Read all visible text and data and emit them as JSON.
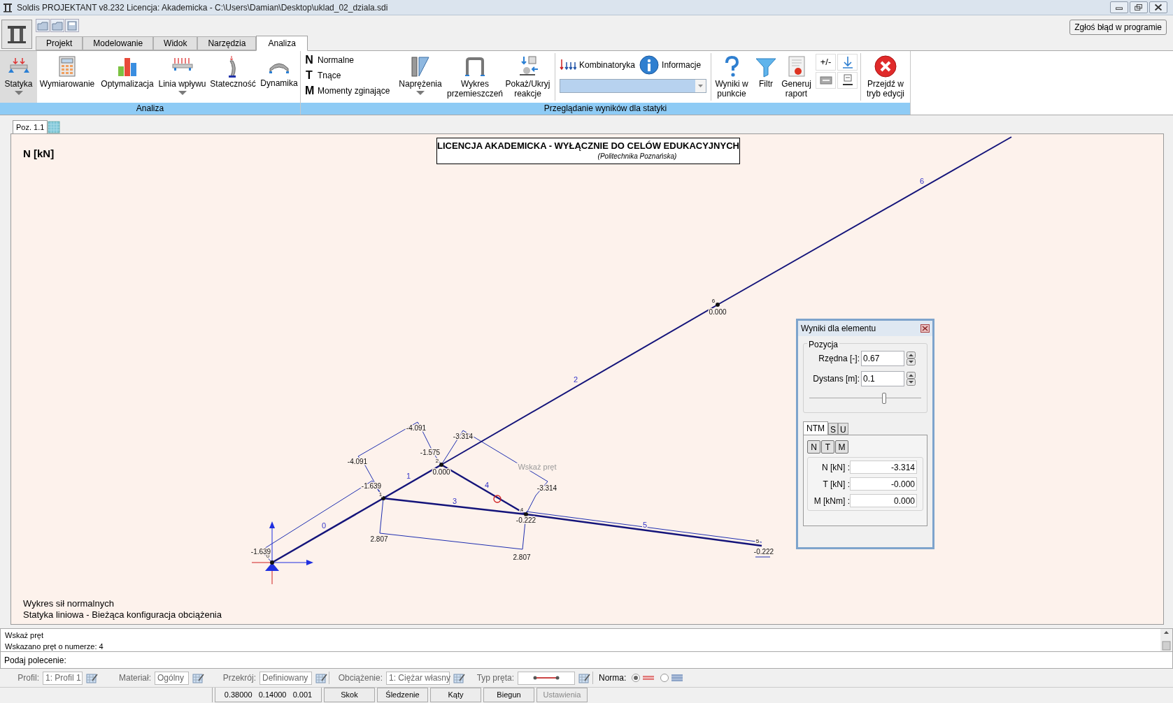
{
  "window": {
    "title": "Soldis PROJEKTANT v8.232 Licencja: Akademicka - C:\\Users\\Damian\\Desktop\\uklad_02_dziala.sdi"
  },
  "report_button": "Zgłoś błąd w programie",
  "tabs": [
    {
      "label": "Projekt",
      "selected": false
    },
    {
      "label": "Modelowanie",
      "selected": false
    },
    {
      "label": "Widok",
      "selected": false
    },
    {
      "label": "Narzędzia",
      "selected": false
    },
    {
      "label": "Analiza",
      "selected": true
    }
  ],
  "analysis_group": {
    "label": "Analiza",
    "buttons": [
      {
        "label": "Statyka",
        "selected": true,
        "dropdown": true
      },
      {
        "label": "Wymiarowanie",
        "selected": false,
        "dropdown": false
      },
      {
        "label": "Optymalizacja",
        "selected": false,
        "dropdown": false
      },
      {
        "label": "Linia wpływu",
        "selected": false,
        "dropdown": true
      },
      {
        "label": "Stateczność",
        "selected": false,
        "dropdown": false
      },
      {
        "label": "Dynamika",
        "selected": false,
        "dropdown": false
      }
    ]
  },
  "results_group": {
    "label": "Przeglądanie wyników dla statyki",
    "force_types": [
      {
        "letter": "N",
        "label": "Normalne"
      },
      {
        "letter": "T",
        "label": "Tnące"
      },
      {
        "letter": "M",
        "label": "Momenty zginające"
      }
    ],
    "view_buttons": [
      {
        "label": "Naprężenia",
        "dropdown": true
      },
      {
        "label": "Wykres\nprzemieszczeń",
        "dropdown": false
      },
      {
        "label": "Pokaż/Ukryj\nreakcje",
        "dropdown": false
      }
    ],
    "combinatorics": "Kombinatoryka",
    "information": "Informacje",
    "tool_buttons": [
      {
        "label": "Wyniki w\npunkcie"
      },
      {
        "label": "Filtr"
      },
      {
        "label": "Generuj\nraport"
      }
    ],
    "sign_toggle": "+/-",
    "exit_button": "Przejdź w\ntryb edycji"
  },
  "document_tab": {
    "label": "Poz. 1.1",
    "selected": true
  },
  "canvas": {
    "quantity": "N [kN]",
    "license": "LICENCJA AKADEMICKA - WYŁĄCZNIE DO CELÓW EDUKACYJNYCH",
    "institution": "(Politechnika Poznańska)",
    "caption": [
      "Wykres sił normalnych",
      "Statyka liniowa - Bieżąca konfiguracja obciążenia"
    ]
  },
  "diagram": {
    "member_numbers": [
      "0",
      "1",
      "2",
      "3",
      "4",
      "5",
      "6"
    ],
    "node_numbers": [
      "0",
      "1",
      "2",
      "4",
      "5",
      "6"
    ],
    "values": [
      "-1.639",
      "-1.639",
      "-4.091",
      "-4.091",
      "-1.575",
      "0.000",
      "-3.314",
      "-3.314",
      "-0.222",
      "2.807",
      "2.807",
      "0.000",
      "-0.222"
    ],
    "hint": "Wskaż pręt"
  },
  "dialog": {
    "title": "Wyniki dla elementu",
    "group": "Pozycja",
    "fields": [
      {
        "label": "Rzędna [-]:",
        "value": "0.67"
      },
      {
        "label": "Dystans [m]:",
        "value": "0.1"
      }
    ],
    "slider": {
      "level": 0.67
    },
    "tabs": [
      {
        "label": "NTM",
        "selected": true
      },
      {
        "label": "S",
        "selected": false
      },
      {
        "label": "U",
        "selected": false
      }
    ],
    "buttons": [
      "N",
      "T",
      "M"
    ],
    "results": [
      {
        "label": "N [kN] :",
        "value": "-3.314"
      },
      {
        "label": "T [kN] :",
        "value": "-0.000"
      },
      {
        "label": "M [kNm] :",
        "value": "0.000"
      }
    ]
  },
  "messages": [
    "Wskaż pręt",
    "Wskazano pręt o numerze: 4"
  ],
  "command": {
    "label": "Podaj polecenie:"
  },
  "properties": [
    {
      "kind": "field",
      "label": "Profil:",
      "value": "1: Profil 1"
    },
    {
      "kind": "field",
      "label": "Materiał:",
      "value": "Ogólny"
    },
    {
      "kind": "field",
      "label": "Przekrój:",
      "value": "Definiowany"
    },
    {
      "kind": "field",
      "label": "Obciążenie:",
      "value": "1: Ciężar własny"
    },
    {
      "kind": "line",
      "label": "Typ pręta:"
    }
  ],
  "norma": {
    "label": "Norma:",
    "options": [
      {
        "selected": true
      },
      {
        "selected": false
      }
    ]
  },
  "status_bar": {
    "coordinates": "0.38000   0.14000   0.001",
    "buttons": [
      {
        "label": "Skok",
        "disabled": false
      },
      {
        "label": "Śledzenie",
        "disabled": false
      },
      {
        "label": "Kąty",
        "disabled": false
      },
      {
        "label": "Biegun",
        "disabled": false
      },
      {
        "label": "Ustawienia",
        "disabled": true
      }
    ]
  }
}
